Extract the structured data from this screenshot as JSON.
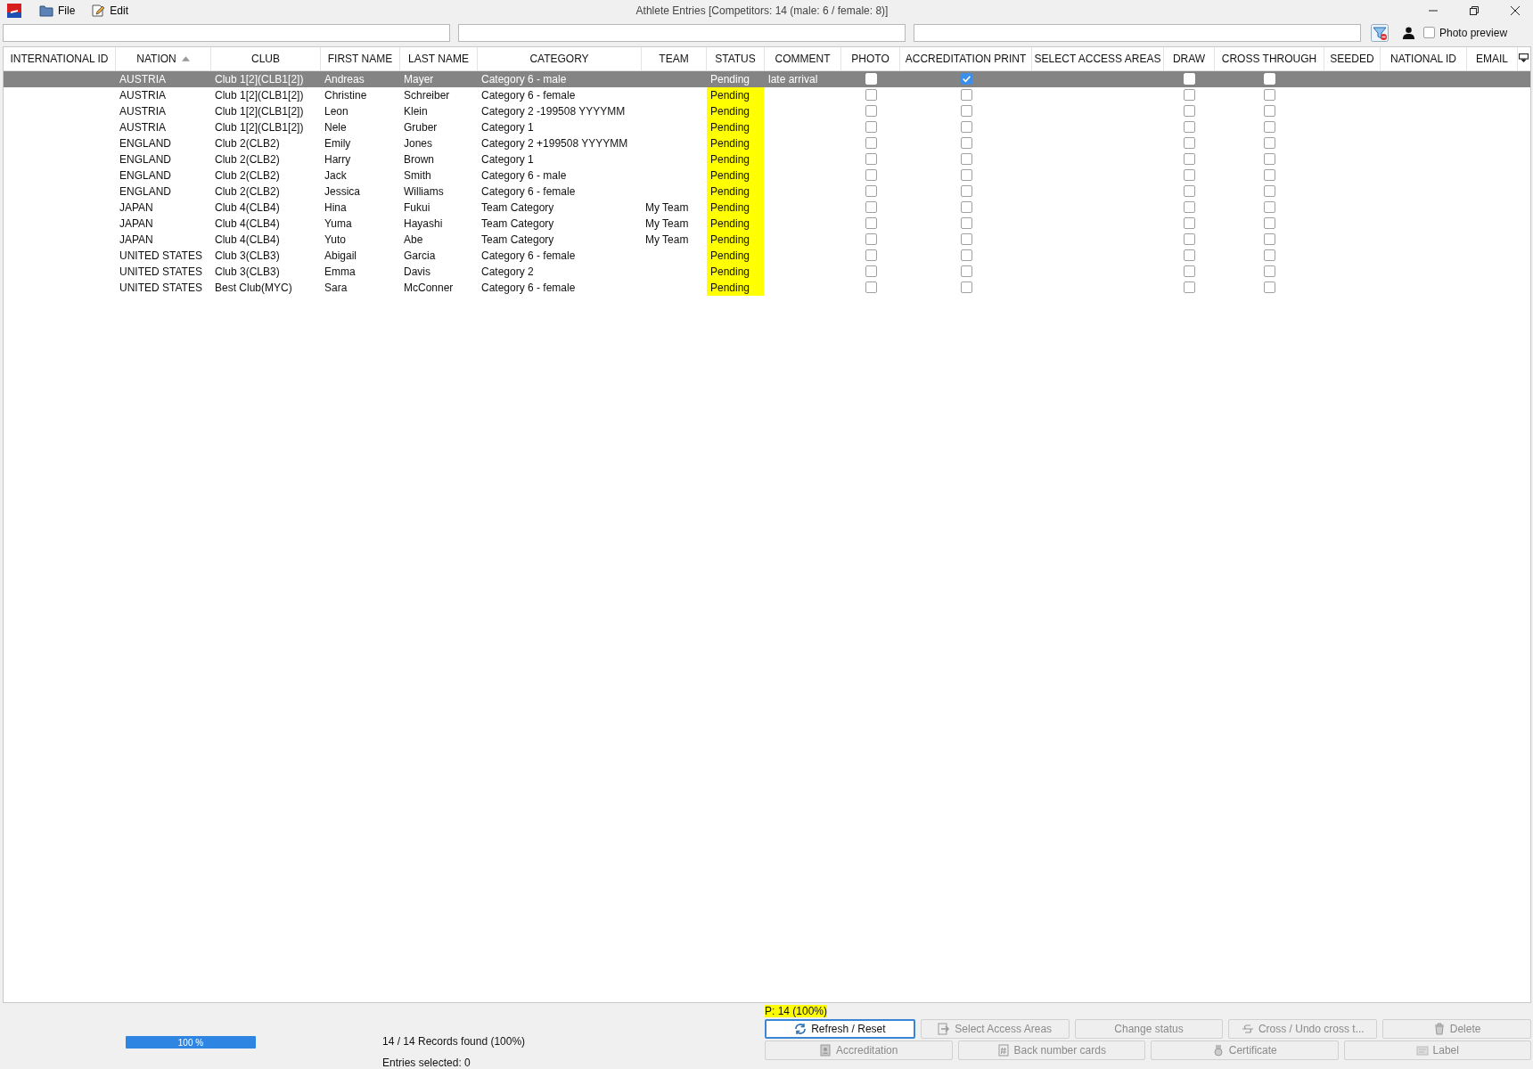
{
  "window": {
    "menus": [
      "File",
      "Edit"
    ],
    "title": "Athlete Entries [Competitors: 14 (male: 6 / female: 8)]"
  },
  "toolbar": {
    "photo_preview": {
      "label": "Photo preview",
      "checked": false
    }
  },
  "table": {
    "columns": [
      {
        "label": "INTERNATIONAL ID",
        "sorted": false
      },
      {
        "label": "NATION",
        "sorted": true
      },
      {
        "label": "CLUB",
        "sorted": false
      },
      {
        "label": "FIRST NAME",
        "sorted": false
      },
      {
        "label": "LAST NAME",
        "sorted": false
      },
      {
        "label": "CATEGORY",
        "sorted": false
      },
      {
        "label": "TEAM",
        "sorted": false
      },
      {
        "label": "STATUS",
        "sorted": false
      },
      {
        "label": "COMMENT",
        "sorted": false
      },
      {
        "label": "PHOTO",
        "sorted": false
      },
      {
        "label": "ACCREDITATION PRINT",
        "sorted": false
      },
      {
        "label": "SELECT ACCESS AREAS",
        "sorted": false
      },
      {
        "label": "DRAW",
        "sorted": false
      },
      {
        "label": "CROSS THROUGH",
        "sorted": false
      },
      {
        "label": "SEEDED",
        "sorted": false
      },
      {
        "label": "NATIONAL ID",
        "sorted": false
      },
      {
        "label": "EMAIL",
        "sorted": false
      }
    ],
    "rows": [
      {
        "selected": true,
        "nation": "AUSTRIA",
        "club": "Club 1[2](CLB1[2])",
        "first_name": "Andreas",
        "last_name": "Mayer",
        "category": "Category 6 - male",
        "status": "Pending",
        "comment": "late arrival",
        "photo": false,
        "accreditation_print": true,
        "draw": false,
        "cross_through": false
      },
      {
        "selected": false,
        "nation": "AUSTRIA",
        "club": "Club 1[2](CLB1[2])",
        "first_name": "Christine",
        "last_name": "Schreiber",
        "category": "Category 6 - female",
        "status": "Pending",
        "photo": false,
        "accreditation_print": false,
        "draw": false,
        "cross_through": false
      },
      {
        "selected": false,
        "nation": "AUSTRIA",
        "club": "Club 1[2](CLB1[2])",
        "first_name": "Leon",
        "last_name": "Klein",
        "category": "Category 2 -199508 YYYYMM",
        "status": "Pending",
        "photo": false,
        "accreditation_print": false,
        "draw": false,
        "cross_through": false
      },
      {
        "selected": false,
        "nation": "AUSTRIA",
        "club": "Club 1[2](CLB1[2])",
        "first_name": "Nele",
        "last_name": "Gruber",
        "category": "Category 1",
        "status": "Pending",
        "photo": false,
        "accreditation_print": false,
        "draw": false,
        "cross_through": false
      },
      {
        "selected": false,
        "nation": "ENGLAND",
        "club": "Club 2(CLB2)",
        "first_name": "Emily",
        "last_name": "Jones",
        "category": "Category 2 +199508 YYYYMM",
        "status": "Pending",
        "photo": false,
        "accreditation_print": false,
        "draw": false,
        "cross_through": false
      },
      {
        "selected": false,
        "nation": "ENGLAND",
        "club": "Club 2(CLB2)",
        "first_name": "Harry",
        "last_name": "Brown",
        "category": "Category 1",
        "status": "Pending",
        "photo": false,
        "accreditation_print": false,
        "draw": false,
        "cross_through": false
      },
      {
        "selected": false,
        "nation": "ENGLAND",
        "club": "Club 2(CLB2)",
        "first_name": "Jack",
        "last_name": "Smith",
        "category": "Category 6 - male",
        "status": "Pending",
        "photo": false,
        "accreditation_print": false,
        "draw": false,
        "cross_through": false
      },
      {
        "selected": false,
        "nation": "ENGLAND",
        "club": "Club 2(CLB2)",
        "first_name": "Jessica",
        "last_name": "Williams",
        "category": "Category 6 - female",
        "status": "Pending",
        "photo": false,
        "accreditation_print": false,
        "draw": false,
        "cross_through": false
      },
      {
        "selected": false,
        "nation": "JAPAN",
        "club": "Club 4(CLB4)",
        "first_name": "Hina",
        "last_name": "Fukui",
        "category": "Team Category",
        "team": "My Team",
        "status": "Pending",
        "photo": false,
        "accreditation_print": false,
        "draw": false,
        "cross_through": false
      },
      {
        "selected": false,
        "nation": "JAPAN",
        "club": "Club 4(CLB4)",
        "first_name": "Yuma",
        "last_name": "Hayashi",
        "category": "Team Category",
        "team": "My Team",
        "status": "Pending",
        "photo": false,
        "accreditation_print": false,
        "draw": false,
        "cross_through": false
      },
      {
        "selected": false,
        "nation": "JAPAN",
        "club": "Club 4(CLB4)",
        "first_name": "Yuto",
        "last_name": "Abe",
        "category": "Team Category",
        "team": "My Team",
        "status": "Pending",
        "photo": false,
        "accreditation_print": false,
        "draw": false,
        "cross_through": false
      },
      {
        "selected": false,
        "nation": "UNITED STATES",
        "club": "Club 3(CLB3)",
        "first_name": "Abigail",
        "last_name": "Garcia",
        "category": "Category 6 - female",
        "status": "Pending",
        "photo": false,
        "accreditation_print": false,
        "draw": false,
        "cross_through": false
      },
      {
        "selected": false,
        "nation": "UNITED STATES",
        "club": "Club 3(CLB3)",
        "first_name": "Emma",
        "last_name": "Davis",
        "category": "Category 2",
        "status": "Pending",
        "photo": false,
        "accreditation_print": false,
        "draw": false,
        "cross_through": false
      },
      {
        "selected": false,
        "nation": "UNITED STATES",
        "club": "Best Club(MYC)",
        "first_name": "Sara",
        "last_name": "McConner",
        "category": "Category 6 - female",
        "status": "Pending",
        "photo": false,
        "accreditation_print": false,
        "draw": false,
        "cross_through": false
      }
    ]
  },
  "status_bar": {
    "pending_summary": "P: 14 (100%)",
    "progress": {
      "level": 1,
      "label": "100 %"
    },
    "records": "14 / 14 Records found (100%)",
    "entries_selected": "Entries selected: 0",
    "buttons": [
      {
        "label": "Refresh / Reset",
        "disabled": false
      },
      {
        "label": "Select Access Areas",
        "disabled": true
      },
      {
        "label": "Change status",
        "disabled": true
      },
      {
        "label": "Cross / Undo cross t...",
        "disabled": true
      },
      {
        "label": "Delete",
        "disabled": true
      },
      {
        "label": "Accreditation",
        "disabled": true
      },
      {
        "label": "Back number cards",
        "disabled": true
      },
      {
        "label": "Certificate",
        "disabled": true
      },
      {
        "label": "Label",
        "disabled": true
      }
    ]
  }
}
